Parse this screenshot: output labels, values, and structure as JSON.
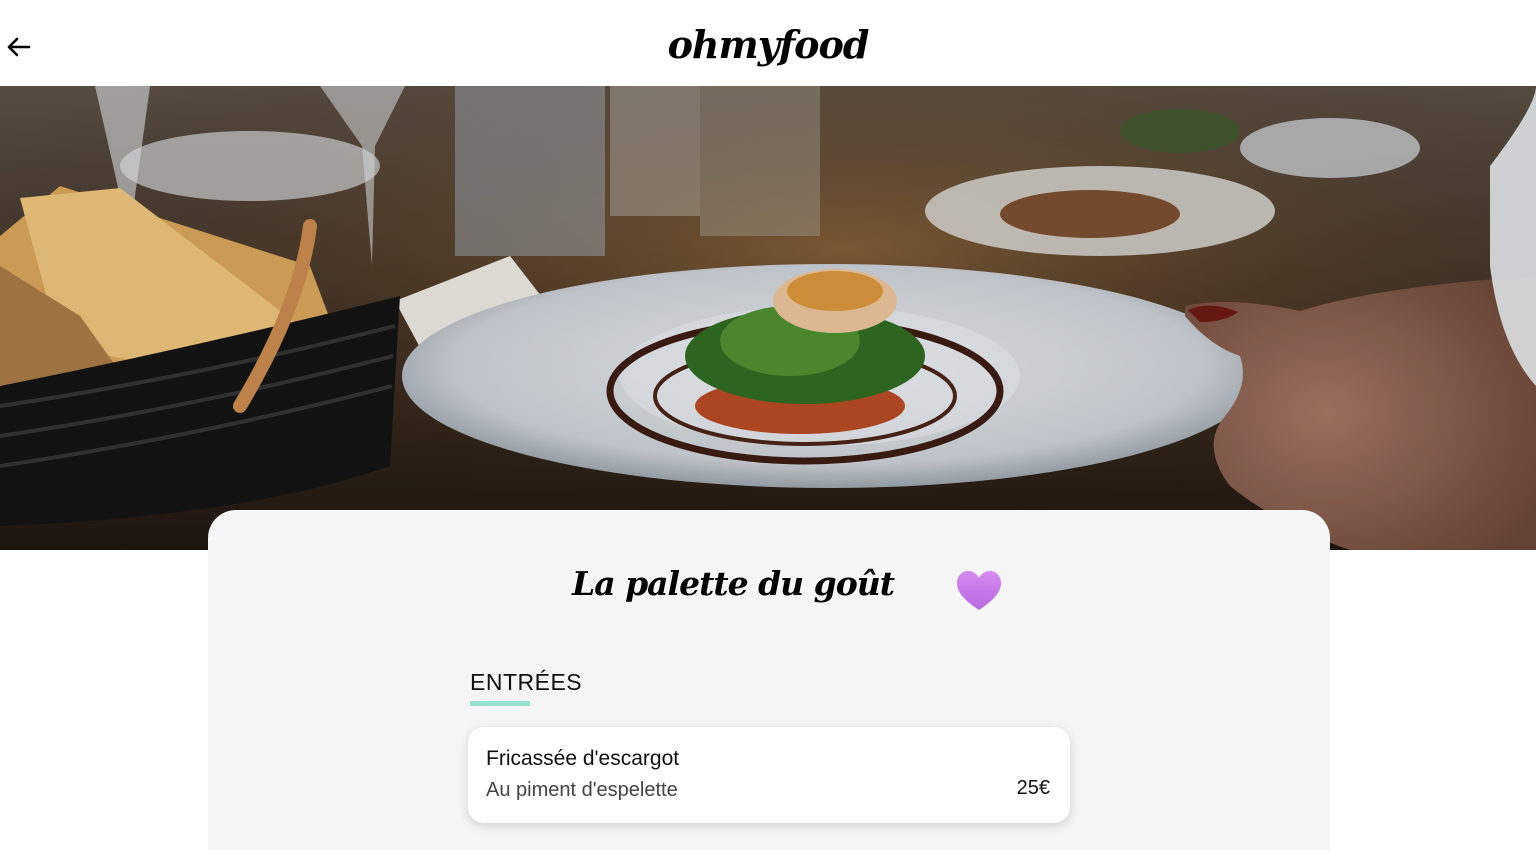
{
  "header": {
    "logo": "ohmyfood",
    "back_icon": "arrow-left-icon"
  },
  "hero": {
    "image": "restaurant-dish-photo"
  },
  "restaurant": {
    "name": "La palette du goût",
    "like_icon": "heart-icon",
    "like_color": "#c77ee8"
  },
  "menu": {
    "sections": [
      {
        "title": "ENTRÉES",
        "accent": "#99e2d0",
        "dishes": [
          {
            "name": "Fricassée d'escargot",
            "description": "Au piment d'espelette",
            "price": "25€"
          }
        ]
      }
    ]
  }
}
